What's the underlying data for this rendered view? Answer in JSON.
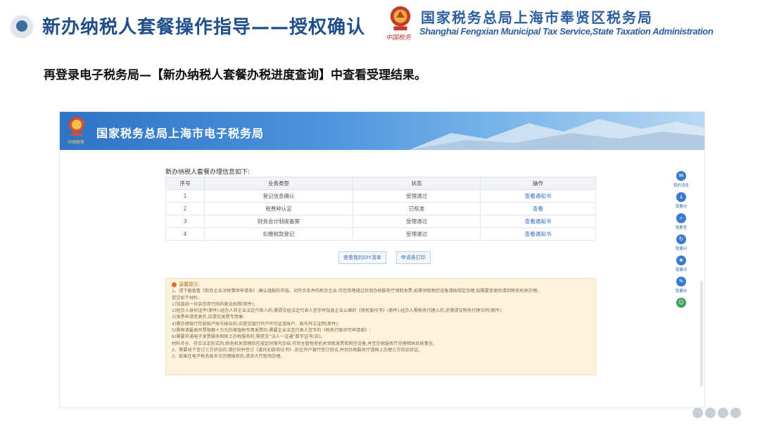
{
  "slide": {
    "title": "新办纳税人套餐操作指导——授权确认",
    "org_cn": "国家税务总局上海市奉贤区税务局",
    "org_en": "Shanghai Fengxian Municipal Tax Service,State Taxation Administration",
    "emblem_caption": "中国税务",
    "instruction": "再登录电子税务局—【新办纳税人套餐办税进度查询】中查看受理结果。"
  },
  "portal": {
    "banner_title": "国家税务总局上海市电子税务局",
    "banner_sub": "中国税务",
    "content_label": "新办纳税人套餐办理信息如下:",
    "table": {
      "headers": [
        "序号",
        "业务类型",
        "状态",
        "操作"
      ],
      "rows": [
        {
          "no": "1",
          "type": "登记信息确认",
          "status": "受理通过",
          "action": "查看通知书"
        },
        {
          "no": "2",
          "type": "税费种认定",
          "status": "已核准",
          "action": "查看"
        },
        {
          "no": "3",
          "type": "财务会计制度备案",
          "status": "受理通过",
          "action": "查看通知书"
        },
        {
          "no": "4",
          "type": "扣缴税款登记",
          "status": "受理通过",
          "action": "查看通知书"
        }
      ]
    },
    "buttons": {
      "view_info": "查看我的DIY清单",
      "print": "申请表打印"
    },
    "notice": {
      "title": "温馨提示:",
      "lines": [
        "1、请下载查看《新办企业涉税事项申请表》,确认填报的内容。对符合条件的新办企业,可在受理通过后到办税服务厅领取发票,如需领取税控设备请按规定办理,如需要变更的请到税务机关办理。",
        "提交如下材料:",
        "1)加盖统一社会信用代码的营业执照(原件);",
        "2)经办人身份证件(原件),经办人非企业法定代表人的,需提交经法定代表人签字并加盖企业公章的《授权委托书》(原件);经办人需税务代理人的,还需提交税务代理合同(原件);",
        "3)发票申请变更的,应提交发票专用章;",
        "4)需办理银行存款账户账号报告的,应提交银行开户许可证或账户、账号开立证明(原件);",
        "5)需申请最高开票限额十万元的增值税专用发票的,需要企业法定代表人签字的《税务行政许可申请表》;",
        "6)需要开通电子发票服务和网上办税服务的,需提交“法人一证通”数字证书(正)。",
        "材料齐全、符合法定形式的,税务机关受理后在规定时限内办结,可到主管税务机关领取发票和税控设备,并至办税服务厅办理相关后续事宜。",
        "2、需要线下签订三方协议的,请打印并签订《委托扣款协议书》,前往开户银行签订协议,并到办税服务厅或网上办理三方协议验证。",
        "3、如果在电子税务局多次办理报到的,请去大厅现场办理。"
      ]
    },
    "side_rail": [
      {
        "icon": "chat-icon",
        "label": "我的消息"
      },
      {
        "icon": "download-icon",
        "label": "我要办"
      },
      {
        "icon": "search-icon",
        "label": "我要查"
      },
      {
        "icon": "refresh-icon",
        "label": "我要问"
      },
      {
        "icon": "star-icon",
        "label": "我要评"
      },
      {
        "icon": "edit-icon",
        "label": "我要办"
      },
      {
        "icon": "robot-icon",
        "label": ""
      }
    ]
  },
  "colors": {
    "title_blue": "#1f4f8b",
    "org_blue": "#2c5ea0",
    "link_blue": "#2d6cc0",
    "notice_bg": "#fdf3dd"
  }
}
